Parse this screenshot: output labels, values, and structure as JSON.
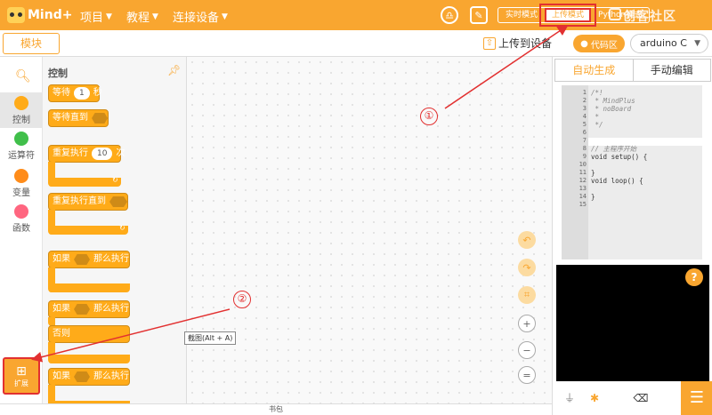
{
  "header": {
    "logo_text": "Mind+",
    "menus": [
      "项目",
      "教程",
      "连接设备"
    ],
    "modes": [
      "实时模式",
      "上传模式",
      "Python模式"
    ],
    "watermark": "创客社区"
  },
  "subbar": {
    "modules_tab": "模块",
    "upload_label": "上传到设备",
    "code_area_label": "代码区",
    "board": "arduino C"
  },
  "categories": [
    {
      "label": "控制",
      "color": "#ffab19"
    },
    {
      "label": "运算符",
      "color": "#40bf4a"
    },
    {
      "label": "变量",
      "color": "#ff8c1a"
    },
    {
      "label": "函数",
      "color": "#ff6680"
    }
  ],
  "extension_label": "扩展",
  "palette": {
    "title": "控制",
    "wait_label": "等待",
    "wait_value": "1",
    "wait_unit": "秒",
    "wait_until_label": "等待直到",
    "repeat_label": "重复执行",
    "repeat_value": "10",
    "repeat_unit": "次",
    "repeat_until_label": "重复执行直到",
    "if_label": "如果",
    "then_label": "那么执行",
    "else_label": "否则"
  },
  "workspace": {
    "tooltip": "截图(Alt + A)",
    "zoom_reset_label": "="
  },
  "right_panel": {
    "tabs": [
      "自动生成",
      "手动编辑"
    ],
    "code_lines": [
      {
        "n": "1",
        "t": "/*!",
        "cm": true
      },
      {
        "n": "2",
        "t": " * MindPlus",
        "cm": true
      },
      {
        "n": "3",
        "t": " * noBoard",
        "cm": true
      },
      {
        "n": "4",
        "t": " *",
        "cm": true
      },
      {
        "n": "5",
        "t": " */",
        "cm": true
      },
      {
        "n": "6",
        "t": "",
        "cm": false
      },
      {
        "n": "7",
        "t": "",
        "cm": false
      },
      {
        "n": "8",
        "t": "// 主程序开始",
        "cm": true
      },
      {
        "n": "9",
        "t": "void setup() {",
        "cm": false
      },
      {
        "n": "10",
        "t": "",
        "cm": false
      },
      {
        "n": "11",
        "t": "}",
        "cm": false
      },
      {
        "n": "12",
        "t": "void loop() {",
        "cm": false
      },
      {
        "n": "13",
        "t": "",
        "cm": false
      },
      {
        "n": "14",
        "t": "}",
        "cm": false
      },
      {
        "n": "15",
        "t": "",
        "cm": false
      }
    ],
    "help_label": "?"
  },
  "bottom": {
    "backpack_label": "书包"
  },
  "annotations": [
    "①",
    "②"
  ]
}
